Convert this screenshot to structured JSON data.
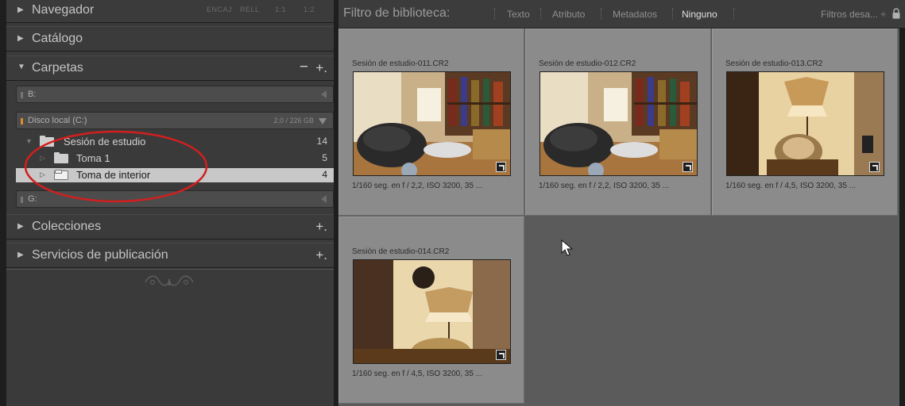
{
  "left_panel": {
    "navigator": {
      "title": "Navegador",
      "options": [
        "ENCAJ",
        "RELL",
        "1:1",
        "1:2"
      ]
    },
    "catalog": {
      "title": "Catálogo"
    },
    "folders": {
      "title": "Carpetas",
      "minus": "−",
      "plus": "+.",
      "volumes": [
        {
          "name": "B:",
          "indicator": "#777777"
        },
        {
          "name": "Disco local (C:)",
          "size": "2,0 / 226 GB",
          "indicator": "#e08a2a"
        },
        {
          "name": "G:",
          "indicator": "#777777"
        }
      ],
      "tree": [
        {
          "label": "Sesión de estudio",
          "count": "14"
        },
        {
          "label": "Toma 1",
          "count": "5"
        },
        {
          "label": "Toma de interior",
          "count": "4"
        }
      ]
    },
    "collections": {
      "title": "Colecciones",
      "plus": "+."
    },
    "publish": {
      "title": "Servicios de publicación",
      "plus": "+."
    },
    "annotation_color": "#d11f1f"
  },
  "filter_bar": {
    "title": "Filtro de biblioteca:",
    "options": [
      "Texto",
      "Atributo",
      "Metadatos",
      "Ninguno"
    ],
    "active": "Ninguno",
    "presets": "Filtros desa... ÷"
  },
  "grid": {
    "cells": [
      {
        "file": "Sesión de estudio-011.CR2",
        "meta": "1/160 seg. en f / 2,2, ISO 3200, 35 ..."
      },
      {
        "file": "Sesión de estudio-012.CR2",
        "meta": "1/160 seg. en f / 2,2, ISO 3200, 35 ..."
      },
      {
        "file": "Sesión de estudio-013.CR2",
        "meta": "1/160 seg. en f / 4,5, ISO 3200, 35 ..."
      },
      {
        "file": "Sesión de estudio-014.CR2",
        "meta": "1/160 seg. en f / 4,5, ISO 3200, 35 ..."
      }
    ]
  }
}
